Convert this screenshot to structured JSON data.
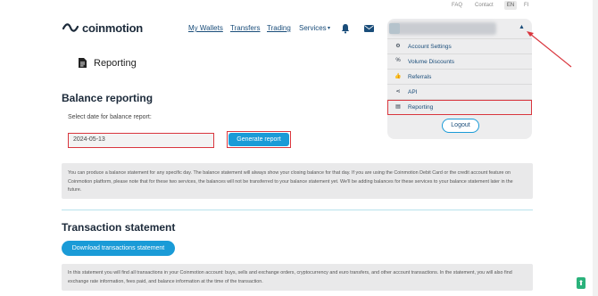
{
  "topbar": {
    "faq": "FAQ",
    "contact": "Contact",
    "lang_en": "EN",
    "lang_fi": "FI"
  },
  "brand": {
    "name": "coinmotion"
  },
  "nav": {
    "my_wallets": "My Wallets",
    "transfers": "Transfers",
    "trading": "Trading",
    "services": "Services",
    "services_chevron": "▾"
  },
  "page": {
    "title": "Reporting"
  },
  "balance": {
    "title": "Balance reporting",
    "date_label": "Select date for balance report:",
    "date_value": "2024-05-13",
    "generate_label": "Generate report",
    "info": "You can produce a balance statement for any specific day. The balance statement will always show your closing balance for that day. If you are using the Coinmotion Debit Card or the credit account feature on Coinmotion platform, please note that for these two services, the balances will not be transferred to your balance statement yet. We'll be adding balances for these services to your balance statement later in the future."
  },
  "transactions": {
    "title": "Transaction statement",
    "download_label": "Download transactions statement",
    "info": "In this statement you will find all transactions in your Coinmotion account: buys, sells and exchange orders, cryptocurrency and euro transfers, and other account transactions. In the statement, you will also find exchange rate information, fees paid, and balance information at the time of the transaction."
  },
  "dropdown": {
    "caret": "▲",
    "items": [
      {
        "label": "Account Settings",
        "icon": "gear-icon",
        "glyph": "⚙"
      },
      {
        "label": "Volume Discounts",
        "icon": "percent-icon",
        "glyph": "%"
      },
      {
        "label": "Referrals",
        "icon": "thumbs-up-icon",
        "glyph": "👍"
      },
      {
        "label": "API",
        "icon": "share-icon",
        "glyph": "⋖"
      },
      {
        "label": "Reporting",
        "icon": "document-icon",
        "glyph": "▤"
      }
    ],
    "logout_label": "Logout"
  },
  "scroll_top": {
    "glyph": "⬆"
  },
  "colors": {
    "accent": "#1a9bd7",
    "brand_dark": "#1c2a3a",
    "link": "#1a4d7a",
    "highlight": "#d9363e",
    "panel": "#ededee"
  }
}
